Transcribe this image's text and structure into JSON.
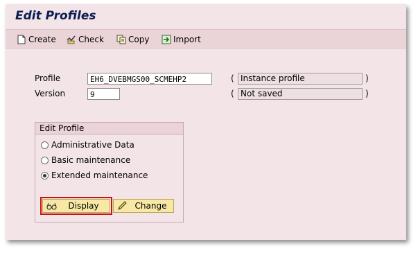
{
  "window": {
    "title": "Edit Profiles"
  },
  "toolbar": {
    "create_label": "Create",
    "check_label": "Check",
    "copy_label": "Copy",
    "import_label": "Import"
  },
  "form": {
    "profile_label": "Profile",
    "profile_value": "EH6_DVEBMGS00_SCMEHP2",
    "profile_type": "Instance profile",
    "version_label": "Version",
    "version_value": "9",
    "version_status": "Not saved",
    "paren_open": "(",
    "paren_close": ")"
  },
  "edit_profile": {
    "heading": "Edit Profile",
    "options": [
      "Administrative Data",
      "Basic maintenance",
      "Extended maintenance"
    ],
    "selected": "Extended maintenance",
    "display_label": "Display",
    "change_label": "Change"
  }
}
